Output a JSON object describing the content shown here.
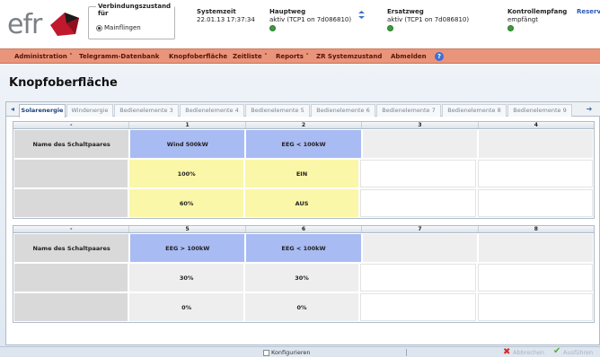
{
  "brand": {
    "logo_text": "efr"
  },
  "header": {
    "connection": {
      "title": "Verbindungszustand für",
      "option": "Mainflingen"
    },
    "systemzeit": {
      "title": "Systemzeit",
      "value": "22.01.13 17:37:34"
    },
    "hauptweg": {
      "title": "Hauptweg",
      "value": "aktiv (TCP1 on 7d086810)"
    },
    "ersatzweg": {
      "title": "Ersatzweg",
      "value": "aktiv (TCP1 on 7d086810)"
    },
    "kontrollempfang": {
      "title": "Kontrollempfang",
      "value": "empfängt"
    },
    "reserve": {
      "title": "Reserv"
    },
    "status_color": "#3d9a3d"
  },
  "menu": {
    "items": [
      "Administration ˅",
      "Telegramm-Datenbank",
      "Knopfoberfläche",
      "Zeitliste ˅",
      "Reports ˅",
      "ZR Systemzustand",
      "Abmelden"
    ],
    "help": "?",
    "color": "#e8957b"
  },
  "page": {
    "title": "Knopfoberfläche"
  },
  "tabs": [
    "Solarenergie",
    "Windenergie",
    "Bedienelemente 3",
    "Bedienelemente 4",
    "Bedienelemente 5",
    "Bedienelemente 6",
    "Bedienelemente 7",
    "Bedienelemente 8",
    "Bedienelemente 9"
  ],
  "tab_arrows": {
    "left": "◂",
    "right": "➔"
  },
  "grid1": {
    "headers": [
      "-",
      "1",
      "2",
      "3",
      "4"
    ],
    "rows": [
      [
        "Name des Schaltpaares",
        "Wind 500kW",
        "EEG < 100kW",
        "",
        ""
      ],
      [
        "",
        "100%",
        "EIN",
        "",
        ""
      ],
      [
        "",
        "60%",
        "AUS",
        "",
        ""
      ]
    ]
  },
  "grid2": {
    "headers": [
      "-",
      "5",
      "6",
      "7",
      "8"
    ],
    "rows": [
      [
        "Name des Schaltpaares",
        "EEG > 100kW",
        "EEG < 100kW",
        "",
        ""
      ],
      [
        "",
        "30%",
        "30%",
        "",
        ""
      ],
      [
        "",
        "0%",
        "0%",
        "",
        ""
      ]
    ]
  },
  "statusbar": {
    "konfigurieren": "Konfigurieren",
    "abbrechen": "Abbrechen",
    "ausfuehren": "Ausführen"
  },
  "colors": {
    "blue": "#a9bbf3",
    "yellow": "#fbf7a8",
    "grey": "#d9d9d9"
  }
}
